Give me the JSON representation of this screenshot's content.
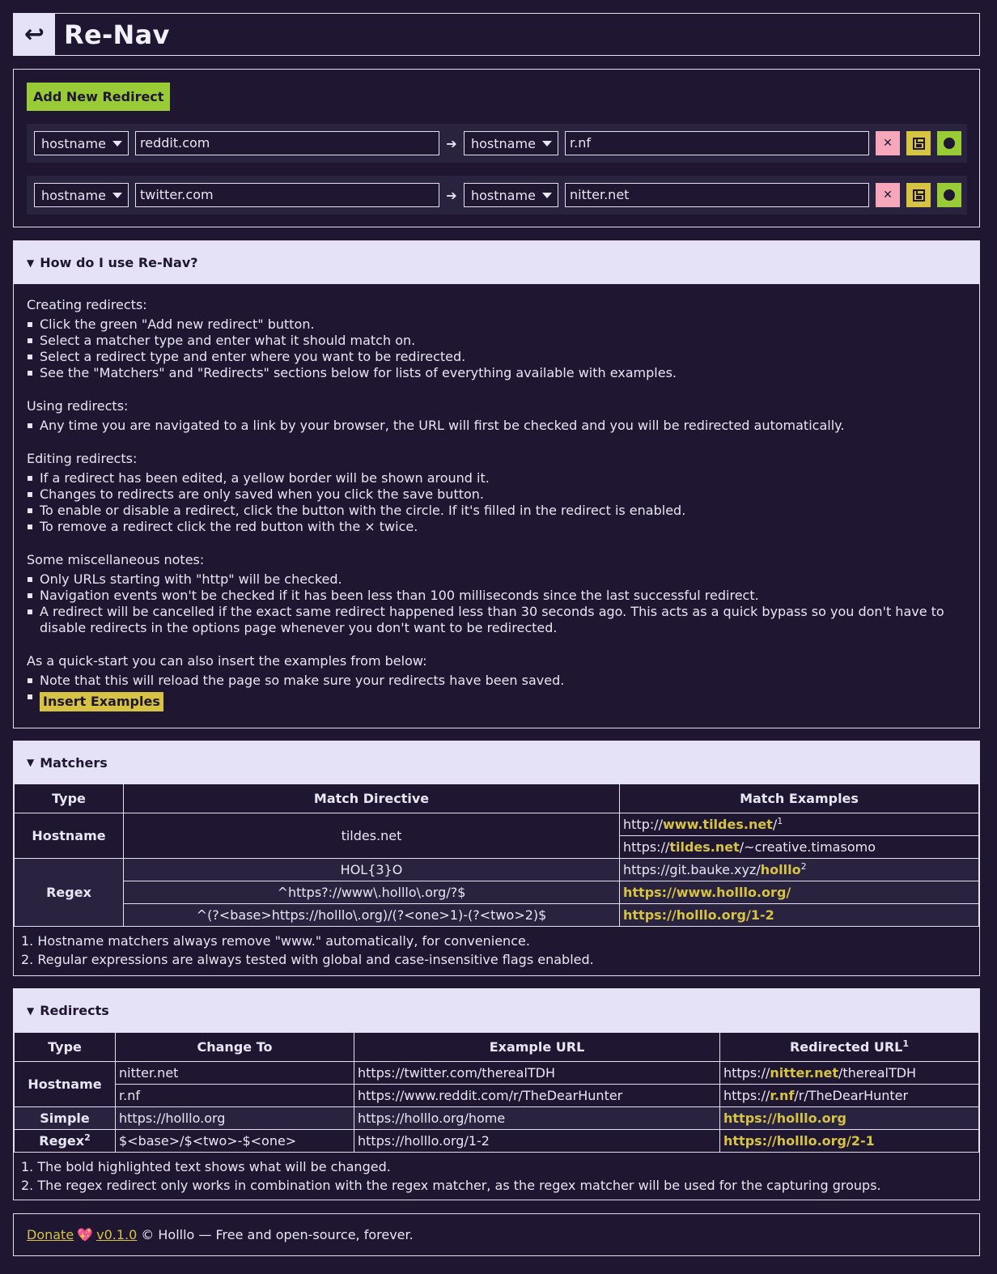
{
  "app": {
    "logo": "↩",
    "title": "Re-Nav"
  },
  "editor": {
    "add_label": "Add New Redirect",
    "rows": [
      {
        "matcher_type": "hostname",
        "match_value": "reddit.com",
        "redirect_type": "hostname",
        "redirect_value": "r.nf"
      },
      {
        "matcher_type": "hostname",
        "match_value": "twitter.com",
        "redirect_type": "hostname",
        "redirect_value": "nitter.net"
      }
    ],
    "arrow": "➔",
    "remove_glyph": "✕"
  },
  "howto": {
    "summary": "How do I use Re-Nav?",
    "groups": [
      {
        "title": "Creating redirects:",
        "items": [
          "Click the green \"Add new redirect\" button.",
          "Select a matcher type and enter what it should match on.",
          "Select a redirect type and enter where you want to be redirected.",
          "See the \"Matchers\" and \"Redirects\" sections below for lists of everything available with examples."
        ]
      },
      {
        "title": "Using redirects:",
        "items": [
          "Any time you are navigated to a link by your browser, the URL will first be checked and you will be redirected automatically."
        ]
      },
      {
        "title": "Editing redirects:",
        "items": [
          "If a redirect has been edited, a yellow border will be shown around it.",
          "Changes to redirects are only saved when you click the save button.",
          "To enable or disable a redirect, click the button with the circle. If it's filled in the redirect is enabled.",
          "To remove a redirect click the red button with the × twice."
        ]
      },
      {
        "title": "Some miscellaneous notes:",
        "items": [
          "Only URLs starting with \"http\" will be checked.",
          "Navigation events won't be checked if it has been less than 100 milliseconds since the last successful redirect.",
          "A redirect will be cancelled if the exact same redirect happened less than 30 seconds ago. This acts as a quick bypass so you don't have to disable redirects in the options page whenever you don't want to be redirected."
        ]
      }
    ],
    "quickstart_title": "As a quick-start you can also insert the examples from below:",
    "quickstart_note": "Note that this will reload the page so make sure your redirects have been saved.",
    "insert_label": "Insert Examples"
  },
  "matchers": {
    "summary": "Matchers",
    "headers": [
      "Type",
      "Match Directive",
      "Match Examples"
    ],
    "hostname": {
      "type": "Hostname",
      "directive": "tildes.net",
      "ex1_pre": "http://",
      "ex1_hl": "www.tildes.net",
      "ex1_post": "/",
      "ex1_sup": "1",
      "ex2_pre": "https://",
      "ex2_hl": "tildes.net",
      "ex2_post": "/~creative.timasomo"
    },
    "regex": {
      "type": "Regex",
      "d1": "HOL{3}O",
      "e1_pre": "https://git.bauke.xyz/",
      "e1_hl": "holllo",
      "e1_sup": "2",
      "d2": "^https?://www\\.holllo\\.org/?$",
      "e2_hl": "https://www.holllo.org/",
      "d3": "^(?<base>https://holllo\\.org)/(?<one>1)-(?<two>2)$",
      "e3_hl": "https://holllo.org/1-2"
    },
    "notes": [
      "1. Hostname matchers always remove \"www.\" automatically, for convenience.",
      "2. Regular expressions are always tested with global and case-insensitive flags enabled."
    ]
  },
  "redirects": {
    "summary": "Redirects",
    "headers": [
      "Type",
      "Change To",
      "Example URL",
      "Redirected URL"
    ],
    "header_sup": "1",
    "hostname": {
      "type": "Hostname",
      "r1_to": "nitter.net",
      "r1_ex": "https://twitter.com/therealTDH",
      "r1_pre": "https://",
      "r1_hl": "nitter.net",
      "r1_post": "/therealTDH",
      "r2_to": "r.nf",
      "r2_ex": "https://www.reddit.com/r/TheDearHunter",
      "r2_pre": "https://",
      "r2_hl": "r.nf",
      "r2_post": "/r/TheDearHunter"
    },
    "simple": {
      "type": "Simple",
      "to": "https://holllo.org",
      "ex": "https://holllo.org/home",
      "hl": "https://holllo.org"
    },
    "regex": {
      "type": "Regex",
      "sup": "2",
      "to": "$<base>/$<two>-$<one>",
      "ex": "https://holllo.org/1-2",
      "hl": "https://holllo.org/2-1"
    },
    "notes": [
      "1. The bold highlighted text shows what will be changed.",
      "2. The regex redirect only works in combination with the regex matcher, as the regex matcher will be used for the capturing groups."
    ]
  },
  "footer": {
    "donate": "Donate",
    "heart": "💖",
    "version": "v0.1.0",
    "text": "© Holllo — Free and open-source, forever."
  }
}
